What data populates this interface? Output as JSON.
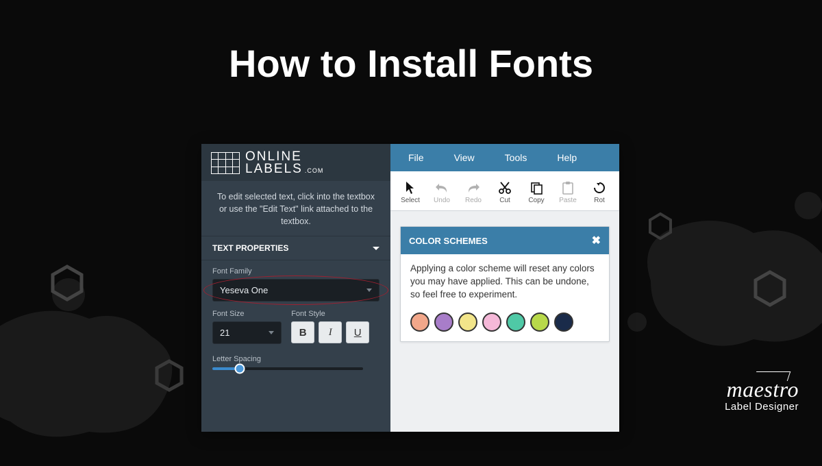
{
  "page_title": "How to Install Fonts",
  "logo": {
    "line1": "ONLINE",
    "line2": "LABELS",
    "suffix": ".COM"
  },
  "sidebar": {
    "help_text": "To edit selected text, click into the textbox or use the \"Edit Text\" link attached to the textbox.",
    "section_title": "TEXT PROPERTIES",
    "font_family_label": "Font Family",
    "font_family_value": "Yeseva One",
    "font_size_label": "Font Size",
    "font_size_value": "21",
    "font_style_label": "Font Style",
    "bold": "B",
    "italic": "I",
    "underline": "U",
    "letter_spacing_label": "Letter Spacing"
  },
  "menubar": [
    "File",
    "View",
    "Tools",
    "Help"
  ],
  "toolbar": [
    {
      "label": "Select",
      "key": "select"
    },
    {
      "label": "Undo",
      "key": "undo"
    },
    {
      "label": "Redo",
      "key": "redo"
    },
    {
      "label": "Cut",
      "key": "cut"
    },
    {
      "label": "Copy",
      "key": "copy"
    },
    {
      "label": "Paste",
      "key": "paste"
    },
    {
      "label": "Rot",
      "key": "rotate"
    }
  ],
  "panel": {
    "title": "COLOR SCHEMES",
    "body": "Applying a color scheme will reset any colors you may have applied. This can be undone, so feel free to experiment.",
    "swatches": [
      "#f2a78a",
      "#a87dc9",
      "#f2e58a",
      "#f5b8d8",
      "#4fc9a6",
      "#b8d94a",
      "#1a2b4a"
    ]
  },
  "brand": {
    "name": "maestro",
    "sub": "Label Designer"
  }
}
